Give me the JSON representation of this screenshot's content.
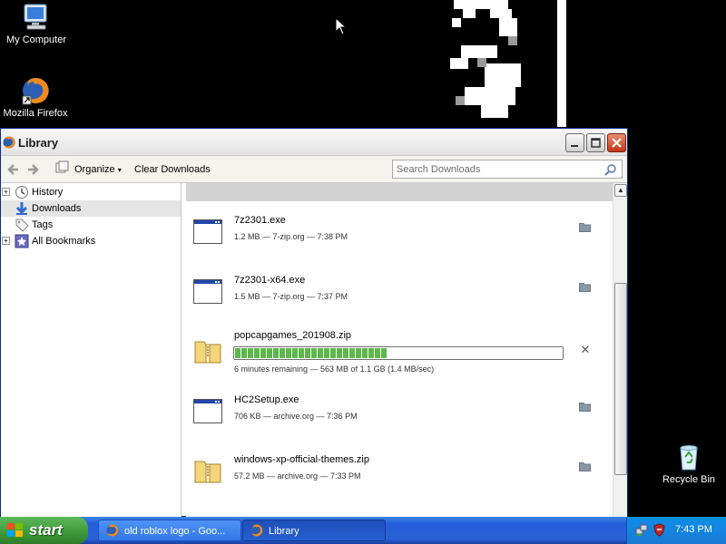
{
  "desktop": {
    "icons": [
      {
        "label": "My Computer",
        "icon": "my-computer-icon"
      },
      {
        "label": "Mozilla Firefox",
        "icon": "firefox-icon"
      },
      {
        "label": "Recycle Bin",
        "icon": "recycle-bin-icon"
      }
    ]
  },
  "window": {
    "title": "Library",
    "toolbar": {
      "organize_label": "Organize",
      "clear_label": "Clear Downloads",
      "search_placeholder": "Search Downloads"
    },
    "sidebar": {
      "items": [
        {
          "label": "History",
          "icon": "history-icon",
          "expandable": true
        },
        {
          "label": "Downloads",
          "icon": "downloads-icon",
          "expandable": false,
          "selected": true
        },
        {
          "label": "Tags",
          "icon": "tag-icon",
          "expandable": false
        },
        {
          "label": "All Bookmarks",
          "icon": "bookmarks-icon",
          "expandable": true
        }
      ]
    },
    "downloads": [
      {
        "name": "7z2301.exe",
        "status": "1.2 MB — 7-zip.org — 7:38 PM",
        "type": "exe"
      },
      {
        "name": "7z2301-x64.exe",
        "status": "1.5 MB — 7-zip.org — 7:37 PM",
        "type": "exe"
      },
      {
        "name": "popcapgames_201908.zip",
        "status": "6 minutes remaining — 563 MB of 1.1 GB (1.4 MB/sec)",
        "type": "zip",
        "in_progress": true,
        "progress": 0.46
      },
      {
        "name": "HC2Setup.exe",
        "status": "706 KB — archive.org — 7:36 PM",
        "type": "exe"
      },
      {
        "name": "windows-xp-official-themes.zip",
        "status": "57.2 MB — archive.org — 7:33 PM",
        "type": "zip"
      }
    ]
  },
  "taskbar": {
    "start_label": "start",
    "tasks": [
      {
        "label": "old roblox logo - Goo...",
        "active": false
      },
      {
        "label": "Library",
        "active": true
      }
    ],
    "clock": "7:43 PM"
  }
}
